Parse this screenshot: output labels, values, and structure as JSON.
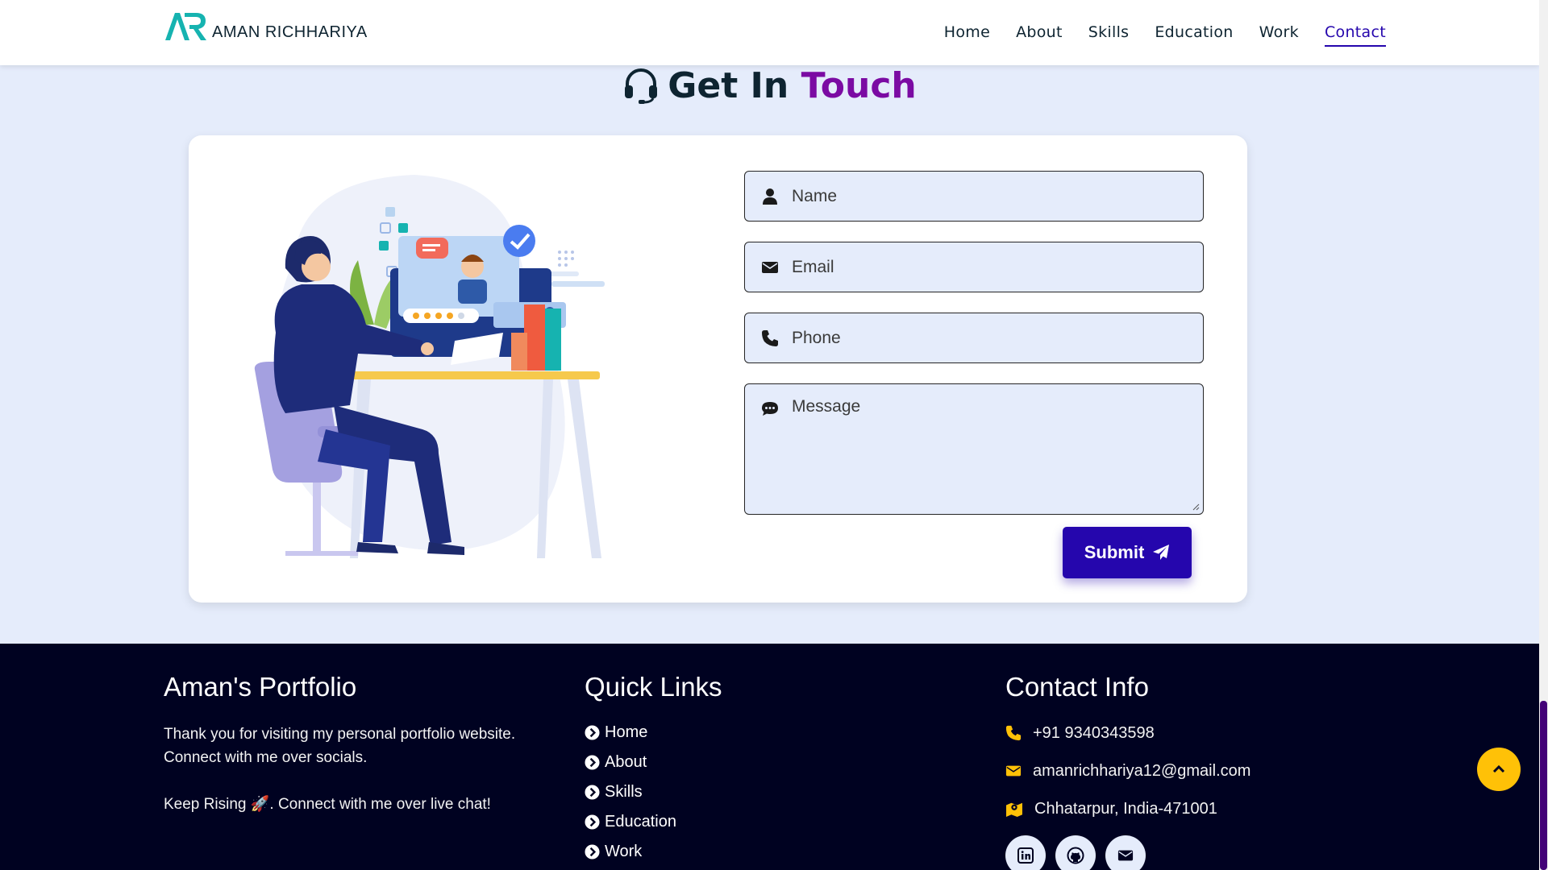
{
  "brand": {
    "name": "AMAN RICHHARIYA",
    "logo_mark": "AR"
  },
  "nav": {
    "items": [
      {
        "label": "Home"
      },
      {
        "label": "About"
      },
      {
        "label": "Skills"
      },
      {
        "label": "Education"
      },
      {
        "label": "Work"
      },
      {
        "label": "Contact",
        "active": true
      }
    ]
  },
  "contact": {
    "heading_main": "Get In",
    "heading_accent": "Touch",
    "heading_icon": "headset-icon",
    "illustration": "customer-support-illustration",
    "form": {
      "name_placeholder": "Name",
      "email_placeholder": "Email",
      "phone_placeholder": "Phone",
      "message_placeholder": "Message",
      "submit_label": "Submit"
    }
  },
  "footer": {
    "about": {
      "title": "Aman's Portfolio",
      "text1": "Thank you for visiting my personal portfolio website. Connect with me over socials.",
      "text2": "Keep Rising 🚀. Connect with me over live chat!"
    },
    "quick_links": {
      "title": "Quick Links",
      "items": [
        "Home",
        "About",
        "Skills",
        "Education",
        "Work"
      ]
    },
    "contact_info": {
      "title": "Contact Info",
      "phone": "+91 9340343598",
      "email": "amanrichhariya12@gmail.com",
      "location": "Chhatarpur, India-471001"
    },
    "socials": [
      "linkedin-icon",
      "github-icon",
      "mail-icon"
    ]
  },
  "colors": {
    "primary": "#2506ad",
    "accent_purple": "#7b0ba3",
    "footer_bg": "#000221",
    "icon_yellow": "#ffc107",
    "section_bg": "#e5ecfb"
  }
}
